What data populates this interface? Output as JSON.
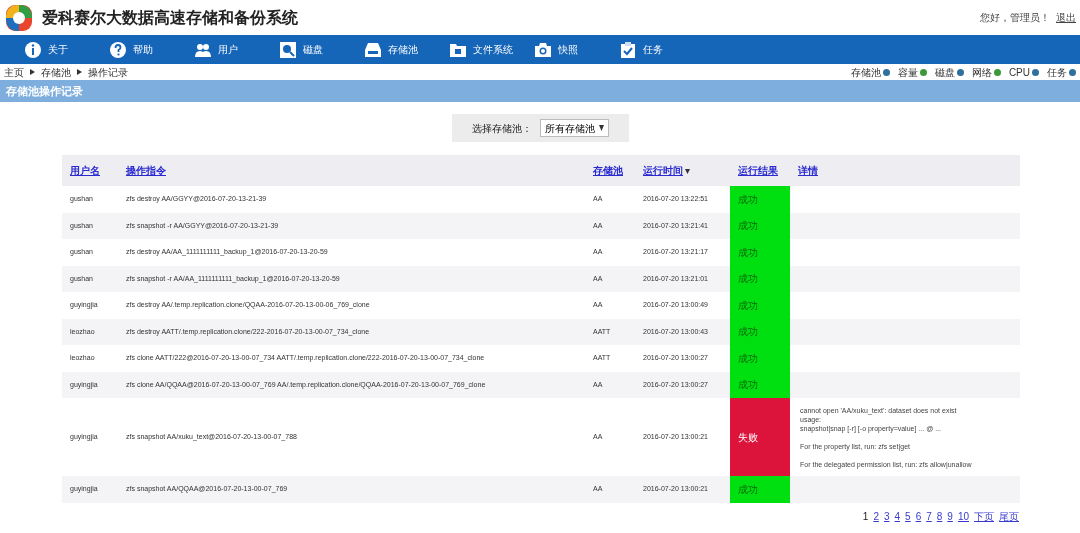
{
  "header": {
    "title": "爱科赛尔大数据高速存储和备份系统",
    "greeting": "您好，管理员！",
    "logout": "退出"
  },
  "nav": [
    "关于",
    "帮助",
    "用户",
    "磁盘",
    "存储池",
    "文件系统",
    "快照",
    "任务"
  ],
  "breadcrumb": [
    "主页",
    "存储池",
    "操作记录"
  ],
  "status_indicators": [
    {
      "label": "存储池",
      "color": "#2e6f9e"
    },
    {
      "label": "容量",
      "color": "#3a9a3a"
    },
    {
      "label": "磁盘",
      "color": "#2e6f9e"
    },
    {
      "label": "网络",
      "color": "#3a9a3a"
    },
    {
      "label": "CPU",
      "color": "#2e6f9e"
    },
    {
      "label": "任务",
      "color": "#2e6f9e"
    }
  ],
  "section_title": "存储池操作记录",
  "pool_filter": {
    "label": "选择存储池：",
    "value": "所有存储池"
  },
  "table": {
    "columns": [
      "用户名",
      "操作指令",
      "存储池",
      "运行时间",
      "运行结果",
      "详情"
    ],
    "sort_mark": "▾",
    "rows": [
      {
        "user": "gushan",
        "command": "zfs destroy AA/GGYY@2016-07-20-13-21-39",
        "pool": "AA",
        "time": "2016-07-20 13:22:51",
        "result": "成功",
        "failed": false
      },
      {
        "user": "gushan",
        "command": "zfs snapshot -r AA/GGYY@2016-07-20-13-21-39",
        "pool": "AA",
        "time": "2016-07-20 13:21:41",
        "result": "成功",
        "failed": false
      },
      {
        "user": "gushan",
        "command": "zfs destroy AA/AA_1111111111_backup_1@2016-07-20-13-20-59",
        "pool": "AA",
        "time": "2016-07-20 13:21:17",
        "result": "成功",
        "failed": false
      },
      {
        "user": "gushan",
        "command": "zfs snapshot -r AA/AA_1111111111_backup_1@2016-07-20-13-20-59",
        "pool": "AA",
        "time": "2016-07-20 13:21:01",
        "result": "成功",
        "failed": false
      },
      {
        "user": "guyingjia",
        "command": "zfs destroy AA/.temp.replication.clone/QQAA-2016-07-20-13-00-06_769_clone",
        "pool": "AA",
        "time": "2016-07-20 13:00:49",
        "result": "成功",
        "failed": false
      },
      {
        "user": "leozhao",
        "command": "zfs destroy AATT/.temp.replication.clone/222-2016-07-20-13-00-07_734_clone",
        "pool": "AATT",
        "time": "2016-07-20 13:00:43",
        "result": "成功",
        "failed": false
      },
      {
        "user": "leozhao",
        "command": "zfs clone AATT/222@2016-07-20-13-00-07_734 AATT/.temp.replication.clone/222-2016-07-20-13-00-07_734_clone",
        "pool": "AATT",
        "time": "2016-07-20 13:00:27",
        "result": "成功",
        "failed": false
      },
      {
        "user": "guyingjia",
        "command": "zfs clone AA/QQAA@2016-07-20-13-00-07_769 AA/.temp.replication.clone/QQAA-2016-07-20-13-00-07_769_clone",
        "pool": "AA",
        "time": "2016-07-20 13:00:27",
        "result": "成功",
        "failed": false
      },
      {
        "user": "guyingjia",
        "command": "zfs snapshot AA/xuku_text@2016-07-20-13-00-07_788",
        "pool": "AA",
        "time": "2016-07-20 13:00:21",
        "result": "失败",
        "failed": true,
        "details": [
          [
            "cannot open 'AA/xuku_text': dataset does not exist",
            "usage:",
            "snapshot|snap [-r] [-o property=value] ... @ ..."
          ],
          [
            "For the property list, run: zfs set|get"
          ],
          [
            "For the delegated permission list, run: zfs allow|unallow"
          ]
        ]
      },
      {
        "user": "guyingjia",
        "command": "zfs snapshot AA/QQAA@2016-07-20-13-00-07_769",
        "pool": "AA",
        "time": "2016-07-20 13:00:21",
        "result": "成功",
        "failed": false
      }
    ]
  },
  "pagination": [
    {
      "label": "1",
      "selected": true
    },
    {
      "label": "2",
      "selected": false
    },
    {
      "label": "3",
      "selected": false
    },
    {
      "label": "4",
      "selected": false
    },
    {
      "label": "5",
      "selected": false
    },
    {
      "label": "6",
      "selected": false
    },
    {
      "label": "7",
      "selected": false
    },
    {
      "label": "8",
      "selected": false
    },
    {
      "label": "9",
      "selected": false
    },
    {
      "label": "10",
      "selected": false
    },
    {
      "label": "下页",
      "selected": false
    },
    {
      "label": "尾页",
      "selected": false
    }
  ]
}
